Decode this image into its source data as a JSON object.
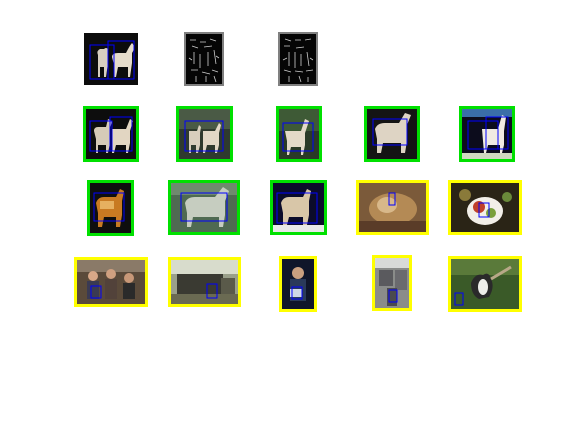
{
  "figure": {
    "query_row": [
      {
        "kind": "query-image",
        "frame": "none",
        "subject": "horse-statue"
      },
      {
        "kind": "edge-map",
        "frame": "gray",
        "subject": "edge-features"
      },
      {
        "kind": "edge-map",
        "frame": "gray",
        "subject": "edge-features"
      }
    ],
    "results": [
      {
        "frame": "green",
        "subject": "horse-statue",
        "correct": true
      },
      {
        "frame": "green",
        "subject": "horse-statue",
        "correct": true
      },
      {
        "frame": "green",
        "subject": "horse-statue",
        "correct": true
      },
      {
        "frame": "green",
        "subject": "horse-statue",
        "correct": true
      },
      {
        "frame": "green",
        "subject": "horse-statue",
        "correct": true
      },
      {
        "frame": "green",
        "subject": "horse-statue-orange",
        "correct": true
      },
      {
        "frame": "green",
        "subject": "horse-statue",
        "correct": true
      },
      {
        "frame": "green",
        "subject": "horse-statue",
        "correct": true
      },
      {
        "frame": "yellow",
        "subject": "cat",
        "correct": false
      },
      {
        "frame": "yellow",
        "subject": "food-plate",
        "correct": false
      },
      {
        "frame": "yellow",
        "subject": "people-group",
        "correct": false
      },
      {
        "frame": "yellow",
        "subject": "train",
        "correct": false
      },
      {
        "frame": "yellow",
        "subject": "person",
        "correct": false
      },
      {
        "frame": "yellow",
        "subject": "street",
        "correct": false
      },
      {
        "frame": "yellow",
        "subject": "bird",
        "correct": false
      }
    ]
  },
  "colors": {
    "correct_frame": "#00e000",
    "incorrect_frame": "#ffff00",
    "edge_frame": "#808080",
    "detection_box": "#0000ff"
  }
}
